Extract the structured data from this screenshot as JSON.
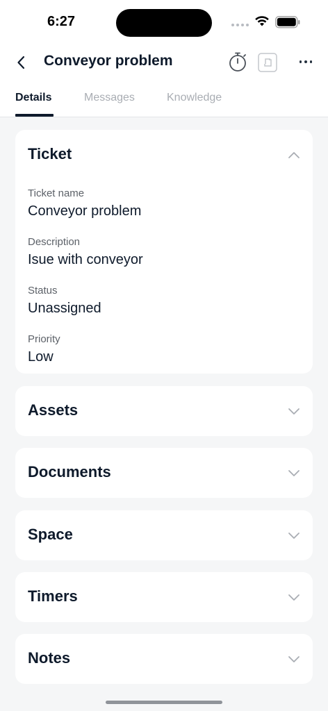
{
  "status_bar": {
    "time": "6:27"
  },
  "nav": {
    "title": "Conveyor problem"
  },
  "tabs": [
    {
      "label": "Details",
      "active": true
    },
    {
      "label": "Messages",
      "active": false
    },
    {
      "label": "Knowledge",
      "active": false
    }
  ],
  "ticket": {
    "title": "Ticket",
    "expanded": true,
    "fields": [
      {
        "label": "Ticket name",
        "value": "Conveyor problem"
      },
      {
        "label": "Description",
        "value": "Isue with conveyor"
      },
      {
        "label": "Status",
        "value": "Unassigned"
      },
      {
        "label": "Priority",
        "value": "Low"
      }
    ]
  },
  "sections": [
    {
      "title": "Assets"
    },
    {
      "title": "Documents"
    },
    {
      "title": "Space"
    },
    {
      "title": "Timers"
    },
    {
      "title": "Notes"
    }
  ],
  "colors": {
    "text": "#0e1a2b",
    "muted": "#a9adb3",
    "background": "#f5f6f7",
    "card": "#ffffff"
  },
  "icons": [
    "back-arrow-icon",
    "stopwatch-icon",
    "expand-icon",
    "more-icon",
    "chevron-up-icon",
    "chevron-down-icon",
    "wifi-icon",
    "battery-icon"
  ]
}
